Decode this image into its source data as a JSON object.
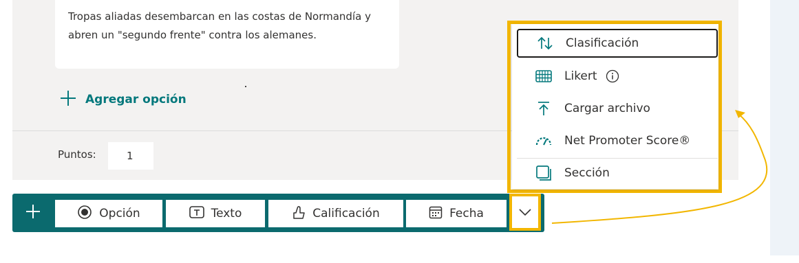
{
  "question": {
    "option_text": "Tropas aliadas desembarcan en las costas de Normandía  y abren un \"segundo frente\" contra los alemanes.",
    "add_option_label": "Agregar opción",
    "points_label": "Puntos:",
    "points_value": "1"
  },
  "toolbar": {
    "add_icon": "plus-icon",
    "buttons": [
      {
        "label": "Opción",
        "icon": "radio-icon"
      },
      {
        "label": "Texto",
        "icon": "text-box-icon"
      },
      {
        "label": "Calificación",
        "icon": "thumb-up-icon"
      },
      {
        "label": "Fecha",
        "icon": "calendar-icon"
      }
    ],
    "more_icon": "chevron-down-icon"
  },
  "dropdown_menu": {
    "items": [
      {
        "label": "Clasificación",
        "icon": "sort-arrows-icon"
      },
      {
        "label": "Likert",
        "icon": "likert-grid-icon",
        "info_icon": "info-icon"
      },
      {
        "label": "Cargar archivo",
        "icon": "upload-icon"
      },
      {
        "label": "Net Promoter Score®",
        "icon": "gauge-icon"
      },
      {
        "label": "Sección",
        "icon": "section-icon"
      }
    ]
  },
  "colors": {
    "accent_teal": "#03787c",
    "toolbar_teal": "#0b6a6e",
    "highlight_yellow": "#f2b600",
    "card_background": "#f3f2f1"
  }
}
